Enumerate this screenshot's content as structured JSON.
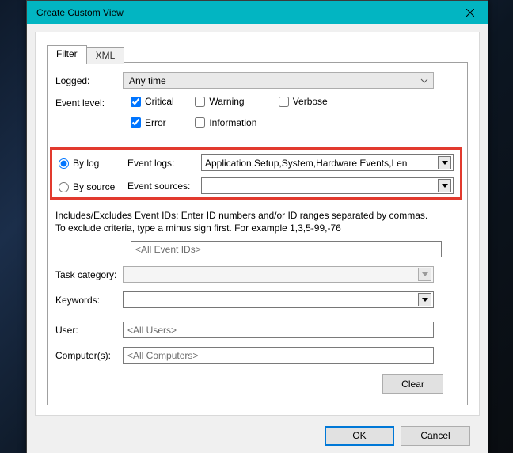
{
  "window": {
    "title": "Create Custom View"
  },
  "tabs": {
    "filter": "Filter",
    "xml": "XML"
  },
  "logged": {
    "label": "Logged:",
    "value": "Any time"
  },
  "level": {
    "label": "Event level:",
    "critical": "Critical",
    "warning": "Warning",
    "verbose": "Verbose",
    "error": "Error",
    "information": "Information"
  },
  "bylog": {
    "label": "By log"
  },
  "bysource": {
    "label": "By source"
  },
  "eventlogs": {
    "label": "Event logs:",
    "value": "Application,Setup,System,Hardware Events,Len"
  },
  "eventsources": {
    "label": "Event sources:",
    "value": ""
  },
  "includes": "Includes/Excludes Event IDs: Enter ID numbers and/or ID ranges separated by commas. To exclude criteria, type a minus sign first. For example 1,3,5-99,-76",
  "eventids_placeholder": "<All Event IDs>",
  "taskcategory": {
    "label": "Task category:"
  },
  "keywords": {
    "label": "Keywords:"
  },
  "user": {
    "label": "User:",
    "placeholder": "<All Users>"
  },
  "computers": {
    "label": "Computer(s):",
    "placeholder": "<All Computers>"
  },
  "buttons": {
    "clear": "Clear",
    "ok": "OK",
    "cancel": "Cancel"
  }
}
